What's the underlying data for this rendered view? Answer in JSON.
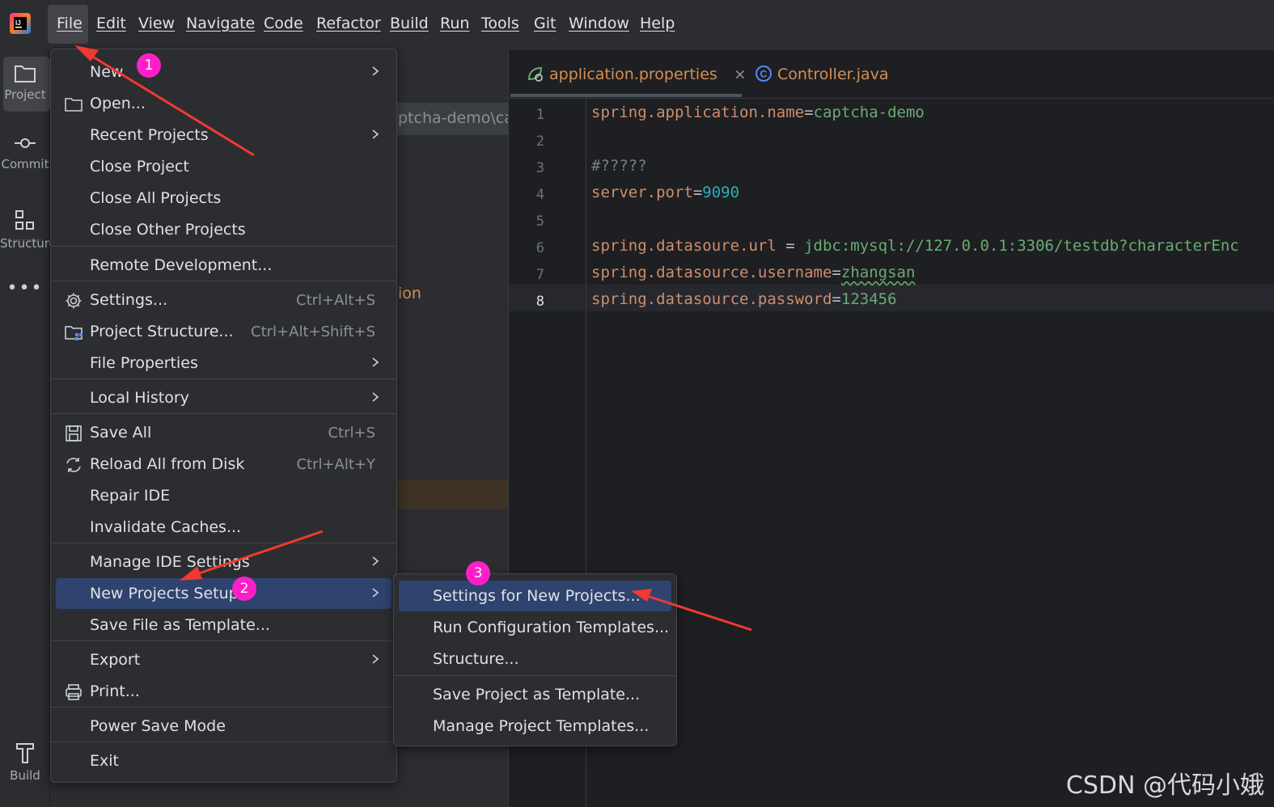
{
  "menubar": {
    "items": [
      "File",
      "Edit",
      "View",
      "Navigate",
      "Code",
      "Refactor",
      "Build",
      "Run",
      "Tools",
      "Git",
      "Window",
      "Help"
    ]
  },
  "toolstrip": {
    "project": "Project",
    "commit": "Commit",
    "structure": "Structure",
    "build": "Build"
  },
  "background": {
    "path_fragment": "ptcha-demo\\cap",
    "fragment_ion": "ion"
  },
  "editor": {
    "tabs": [
      "application.properties",
      "Controller.java"
    ],
    "line_numbers": [
      "1",
      "2",
      "3",
      "4",
      "5",
      "6",
      "7",
      "8"
    ],
    "current_line": 8,
    "lines": [
      {
        "key": "spring.application.name",
        "sep": "=",
        "value": "captcha-demo"
      },
      {
        "key": "",
        "sep": "",
        "value": ""
      },
      {
        "comment": "#?????"
      },
      {
        "key": "server.port",
        "sep": "=",
        "value": "9090"
      },
      {
        "key": "",
        "sep": "",
        "value": ""
      },
      {
        "key": "spring.datasoure.url",
        "sep": " = ",
        "value": "jdbc:mysql://127.0.0.1:3306/testdb?characterEnc"
      },
      {
        "key": "spring.datasource.username",
        "sep": "=",
        "value": "zhangsan"
      },
      {
        "key": "spring.datasource.password",
        "sep": "=",
        "value": "123456"
      }
    ]
  },
  "file_menu": {
    "items": [
      {
        "label": "New",
        "submenu": true
      },
      {
        "label": "Open...",
        "icon": "folder-icon"
      },
      {
        "label": "Recent Projects",
        "submenu": true
      },
      {
        "label": "Close Project"
      },
      {
        "label": "Close All Projects"
      },
      {
        "label": "Close Other Projects"
      },
      {
        "label": "Remote Development..."
      },
      {
        "label": "Settings...",
        "shortcut": "Ctrl+Alt+S",
        "icon": "gear-icon"
      },
      {
        "label": "Project Structure...",
        "shortcut": "Ctrl+Alt+Shift+S",
        "icon": "project-structure-icon"
      },
      {
        "label": "File Properties",
        "submenu": true
      },
      {
        "label": "Local History",
        "submenu": true
      },
      {
        "label": "Save All",
        "shortcut": "Ctrl+S",
        "icon": "save-icon"
      },
      {
        "label": "Reload All from Disk",
        "shortcut": "Ctrl+Alt+Y",
        "icon": "reload-icon"
      },
      {
        "label": "Repair IDE"
      },
      {
        "label": "Invalidate Caches..."
      },
      {
        "label": "Manage IDE Settings",
        "submenu": true
      },
      {
        "label": "New Projects Setup",
        "submenu": true,
        "selected": true
      },
      {
        "label": "Save File as Template..."
      },
      {
        "label": "Export",
        "submenu": true
      },
      {
        "label": "Print...",
        "icon": "print-icon"
      },
      {
        "label": "Power Save Mode"
      },
      {
        "label": "Exit"
      }
    ]
  },
  "sub_menu": {
    "items": [
      {
        "label": "Settings for New Projects...",
        "selected": true
      },
      {
        "label": "Run Configuration Templates..."
      },
      {
        "label": "Structure..."
      },
      {
        "label": "Save Project as Template..."
      },
      {
        "label": "Manage Project Templates..."
      }
    ]
  },
  "annotations": {
    "badges": [
      "1",
      "2",
      "3"
    ],
    "arrow_color": "#ee3a33",
    "badge_color": "#ff1fc8"
  },
  "watermark": "CSDN @代码小娥",
  "colors": {
    "selection": "#2e436e",
    "key": "#cf8e6d",
    "value": "#6aab73",
    "number": "#2aacb8"
  }
}
